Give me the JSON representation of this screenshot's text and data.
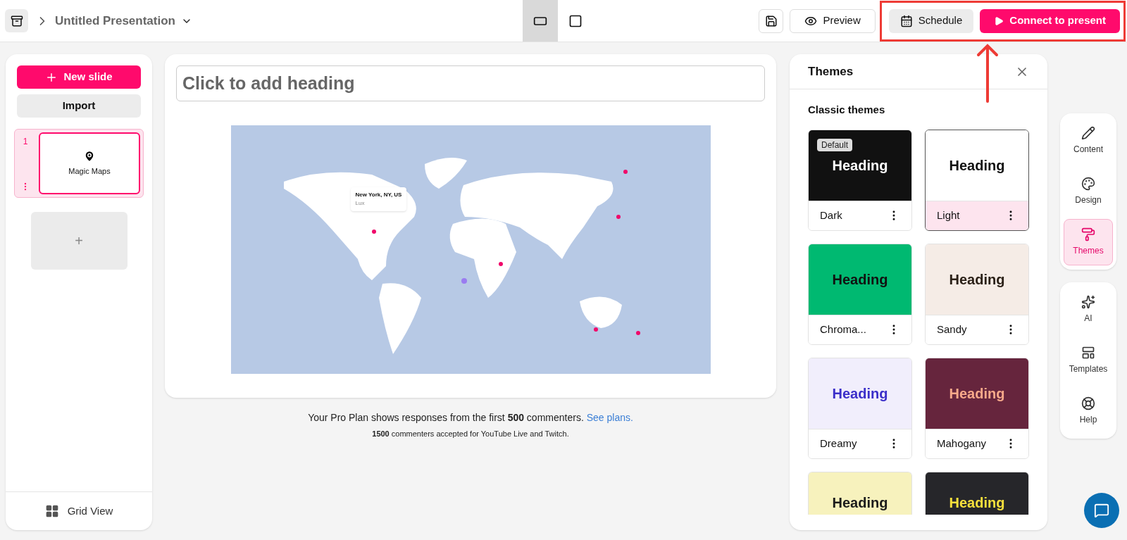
{
  "header": {
    "title": "Untitled Presentation",
    "layouts": [
      {
        "kind": "wide",
        "selected": true
      },
      {
        "kind": "square",
        "selected": false
      }
    ],
    "preview": "Preview",
    "schedule": "Schedule",
    "connect": "Connect to present"
  },
  "slides_panel": {
    "new_slide": "New slide",
    "import": "Import",
    "slides": [
      {
        "number": "1",
        "title": "Magic Maps",
        "selected": true
      }
    ],
    "add": "+",
    "grid_view": "Grid View"
  },
  "editor": {
    "heading_placeholder": "Click to add heading",
    "tooltip": {
      "place": "New York, NY, US",
      "name": "Lux"
    },
    "notice": "Your Pro Plan shows responses from the first **500** commenters.",
    "notice_link": "See plans.",
    "notice_2": "**1500** commenters accepted for YouTube Live and Twitch."
  },
  "themes_panel": {
    "title": "Themes",
    "section": "Classic themes",
    "themes": [
      {
        "name": "Dark",
        "heading": {
          "text": "Heading",
          "color": "#ffffff"
        },
        "color": "#111111",
        "badge": "Default",
        "selected": false,
        "cut": false
      },
      {
        "name": "Light",
        "heading": {
          "text": "Heading",
          "color": "#111111"
        },
        "color": "#ffffff",
        "selected": true,
        "cut": false
      },
      {
        "name": "Chroma...",
        "heading": {
          "text": "Heading",
          "color": "#111111"
        },
        "color": "#00b971",
        "selected": false,
        "cut": false
      },
      {
        "name": "Sandy",
        "heading": {
          "text": "Heading",
          "color": "#2b2118"
        },
        "color": "#f5ece6",
        "selected": false,
        "cut": false
      },
      {
        "name": "Dreamy",
        "heading": {
          "text": "Heading",
          "color": "#3b2fc9"
        },
        "color": "#f1eefc",
        "selected": false,
        "cut": false
      },
      {
        "name": "Mahogany",
        "heading": {
          "text": "Heading",
          "color": "#f7a98a"
        },
        "color": "#66253d",
        "selected": false,
        "cut": false
      },
      {
        "heading": {
          "text": "Heading",
          "color": "#1b1b1b"
        },
        "color": "#f7f2bd",
        "selected": false,
        "cut": true
      },
      {
        "heading": {
          "text": "Heading",
          "color": "#f7e03c"
        },
        "color": "#26262a",
        "selected": false,
        "cut": true
      }
    ]
  },
  "rail": {
    "groups": [
      [
        {
          "kind": "content",
          "label": "Content",
          "selected": false
        },
        {
          "kind": "design",
          "label": "Design",
          "selected": false
        },
        {
          "kind": "themes",
          "label": "Themes",
          "selected": true
        }
      ],
      [
        {
          "kind": "ai",
          "label": "AI",
          "selected": false
        },
        {
          "kind": "templates",
          "label": "Templates",
          "selected": false
        },
        {
          "kind": "help",
          "label": "Help",
          "selected": false
        }
      ]
    ]
  }
}
